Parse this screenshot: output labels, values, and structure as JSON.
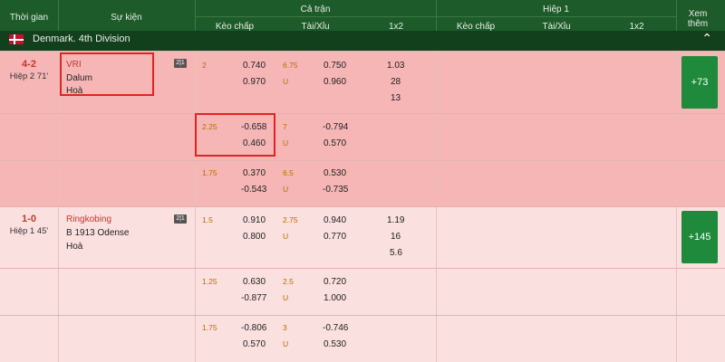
{
  "header": {
    "col_time": "Thời gian",
    "col_event": "Sự kiện",
    "full_match": "Cả trận",
    "half": "Hiệp 1",
    "handicap": "Kèo chấp",
    "over_under": "Tài/Xỉu",
    "x12": "1x2",
    "more": "Xem thêm"
  },
  "league": {
    "name": "Denmark. 4th Division"
  },
  "matches": [
    {
      "score": "4-2",
      "period": "Hiệp 2 71'",
      "home": "VRI",
      "away": "Dalum",
      "draw": "Hoà",
      "more": "+73",
      "lines": [
        {
          "hcap": "2",
          "h1": "0.740",
          "h2": "0.970",
          "ou": "6.75",
          "ou_u": "U",
          "o1": "0.750",
          "o2": "0.960",
          "x1": "1.03",
          "x2": "28",
          "x3": "13"
        },
        {
          "hcap": "2.25",
          "h1": "-0.658",
          "h2": "0.460",
          "ou": "7",
          "ou_u": "U",
          "o1": "-0.794",
          "o2": "0.570"
        },
        {
          "hcap": "1.75",
          "h1": "0.370",
          "h2": "-0.543",
          "ou": "6.5",
          "ou_u": "U",
          "o1": "0.530",
          "o2": "-0.735"
        }
      ]
    },
    {
      "score": "1-0",
      "period": "Hiệp 1 45'",
      "home": "Ringkobing",
      "away": "B 1913 Odense",
      "draw": "Hoà",
      "more": "+145",
      "lines": [
        {
          "hcap": "1.5",
          "h1": "0.910",
          "h2": "0.800",
          "ou": "2.75",
          "ou_u": "U",
          "o1": "0.940",
          "o2": "0.770",
          "x1": "1.19",
          "x2": "16",
          "x3": "5.6"
        },
        {
          "hcap": "1.25",
          "h1": "0.630",
          "h2": "-0.877",
          "ou": "2.5",
          "ou_u": "U",
          "o1": "0.720",
          "o2": "1.000"
        },
        {
          "hcap": "1.75",
          "h1": "-0.806",
          "h2": "0.570",
          "ou": "3",
          "ou_u": "U",
          "o1": "-0.746",
          "o2": "0.530"
        }
      ]
    }
  ]
}
